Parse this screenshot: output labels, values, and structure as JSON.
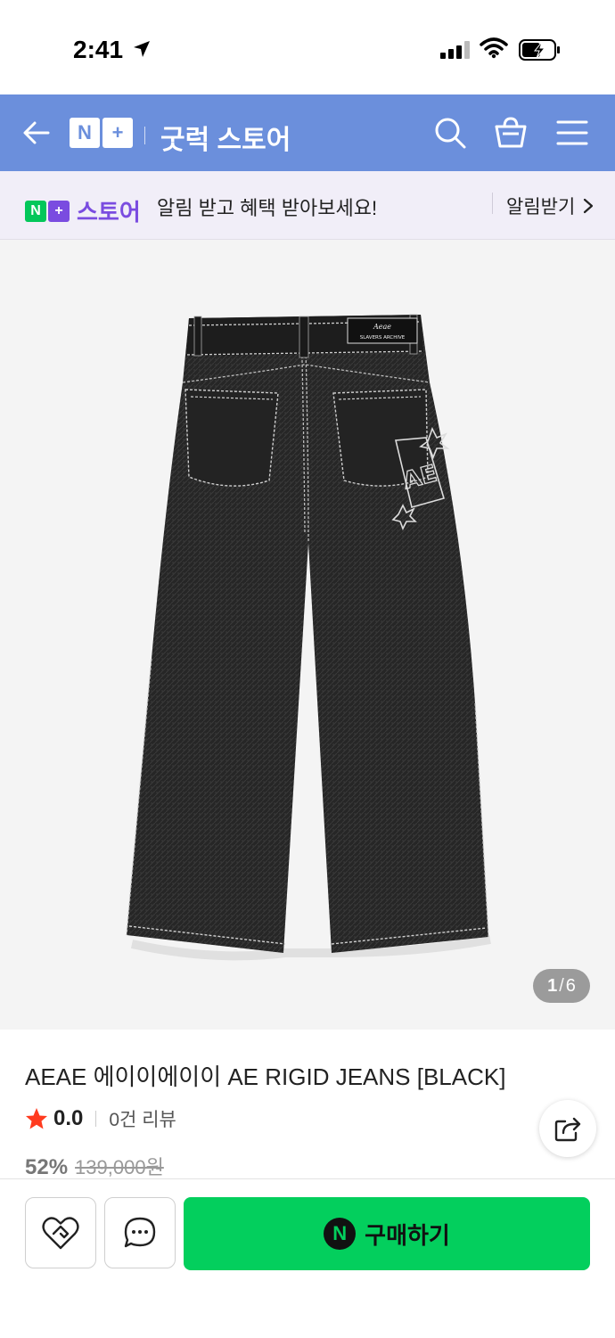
{
  "status_bar": {
    "time": "2:41"
  },
  "header": {
    "brand_badge": [
      "N",
      "+"
    ],
    "store_name": "굿럭 스토어"
  },
  "notice": {
    "badge": [
      "N",
      "+"
    ],
    "store_label": "스토어",
    "message": "알림 받고 혜택 받아보세요!",
    "action_label": "알림받기"
  },
  "gallery": {
    "current": "1",
    "separator": "/",
    "total": "6",
    "patch_text_1": "Aeae",
    "patch_text_2": "SLAVERS ARCHIVE",
    "graphic_text": "AE"
  },
  "product": {
    "title": "AEAE 에이이에이이 AE RIGID JEANS [BLACK]",
    "rating": "0.0",
    "review_count": "0건 리뷰",
    "discount_rate": "52%",
    "original_price": "139,000원"
  },
  "actions": {
    "pay_badge": "N",
    "buy_label": "구매하기"
  },
  "colors": {
    "header_bg": "#6b8fdc",
    "notice_bg": "#f1eef8",
    "buy_button": "#03cf5d",
    "star": "#ff3b1f",
    "naver_green": "#03c75a",
    "store_purple": "#7a4ce0"
  }
}
